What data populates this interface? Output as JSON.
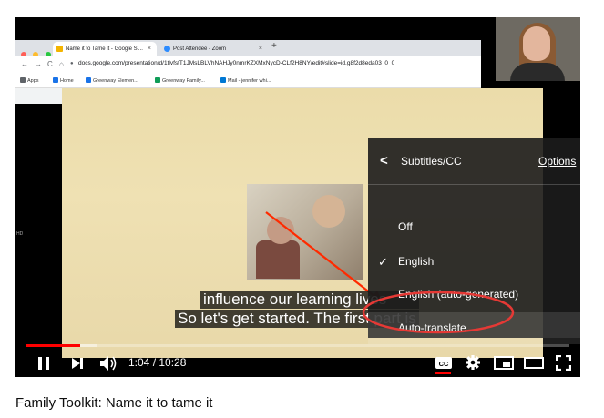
{
  "browser": {
    "tabs": [
      {
        "label": "Name it to Tame it - Google Sl...",
        "favicon_color": "#f4b400"
      },
      {
        "label": "Post Attendee - Zoom",
        "favicon_color": "#2d8cff"
      }
    ],
    "url": "docs.google.com/presentation/d/1tlvfstT1JMsLBLVhNAHJy0nmrKZXMxNycD-CLf2H8NY/edit#slide=id.g8f2d8eda03_0_0",
    "bookmarks": [
      {
        "label": "Apps",
        "color": "#5f6368"
      },
      {
        "label": "Home",
        "color": "#1a73e8"
      },
      {
        "label": "Greenway Elemen...",
        "color": "#1a73e8"
      },
      {
        "label": "Greenway Family...",
        "color": "#0f9d58"
      },
      {
        "label": "Mail - jennifer whi...",
        "color": "#0078d4"
      }
    ]
  },
  "video": {
    "side_label": "HD",
    "captions": [
      "influence our learning lives",
      "So let's get started. The first part is"
    ]
  },
  "subtitles_menu": {
    "title": "Subtitles/CC",
    "options_link": "Options",
    "items": [
      {
        "label": "Off",
        "checked": false
      },
      {
        "label": "English",
        "checked": true
      },
      {
        "label": "English (auto-generated)",
        "checked": false
      },
      {
        "label": "Auto-translate",
        "checked": false
      }
    ],
    "highlight_color": "#e53935"
  },
  "controls": {
    "time": "1:04 / 10:28",
    "progress_played_fraction": 0.1,
    "buffered_fraction": 0.13,
    "cc_label": "CC"
  },
  "video_title": "Family Toolkit: Name it to tame it"
}
